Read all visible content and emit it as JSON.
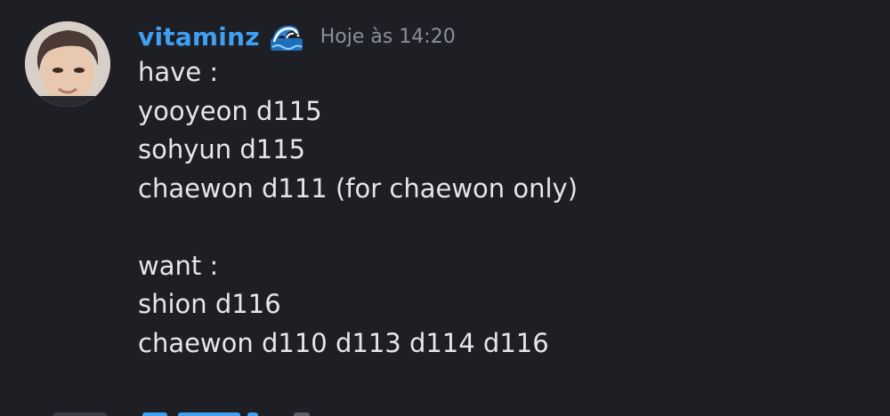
{
  "message": {
    "author": "vitaminz",
    "author_emoji": "wave-emoji-icon",
    "timestamp": "Hoje às 14:20",
    "lines": [
      "have :",
      "yooyeon d115",
      "sohyun d115",
      "chaewon d111 (for chaewon only)",
      "",
      "want :",
      "shion d116",
      "chaewon d110 d113 d114 d116"
    ]
  },
  "colors": {
    "background": "#1e1f25",
    "username": "#3fa0f2",
    "timestamp": "#8b8f98",
    "text": "#e4e6eb"
  }
}
